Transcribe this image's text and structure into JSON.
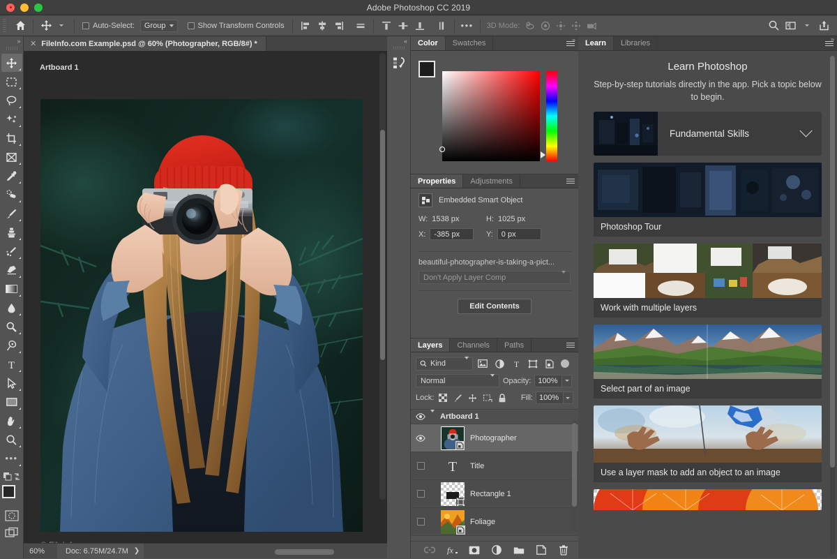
{
  "window": {
    "title": "Adobe Photoshop CC 2019"
  },
  "options_bar": {
    "home_icon": "home-icon",
    "tool_icon": "move-tool-icon",
    "auto_select_label": "Auto-Select:",
    "auto_select_value": "Group",
    "show_transform_label": "Show Transform Controls",
    "more_label": "•••",
    "three_d_mode_label": "3D Mode:",
    "align_icons": [
      "align-left-edges-icon",
      "align-horizontal-centers-icon",
      "align-right-edges-icon",
      "distribute-horizontally-icon"
    ],
    "align_icons2": [
      "align-top-edges-icon",
      "align-vertical-centers-icon",
      "align-bottom-edges-icon",
      "distribute-vertically-icon"
    ],
    "threed_icons": [
      "3d-orbit-icon",
      "3d-roll-icon",
      "3d-pan-icon",
      "3d-slide-icon",
      "3d-camera-icon"
    ],
    "right_icons": [
      "search-icon",
      "workspace-icon",
      "chevron-down-icon",
      "share-icon"
    ]
  },
  "toolbar": {
    "collapse_label": "»",
    "tools": [
      {
        "name": "move-tool",
        "active": true
      },
      {
        "name": "rectangular-marquee-tool",
        "active": false
      },
      {
        "name": "lasso-tool",
        "active": false
      },
      {
        "name": "object-selection-tool",
        "active": false
      },
      {
        "name": "crop-tool",
        "active": false
      },
      {
        "name": "frame-tool",
        "active": false
      },
      {
        "name": "eyedropper-tool",
        "active": false
      },
      {
        "name": "spot-healing-brush-tool",
        "active": false
      },
      {
        "name": "brush-tool",
        "active": false
      },
      {
        "name": "clone-stamp-tool",
        "active": false
      },
      {
        "name": "history-brush-tool",
        "active": false
      },
      {
        "name": "eraser-tool",
        "active": false
      },
      {
        "name": "gradient-tool",
        "active": false
      },
      {
        "name": "blur-tool",
        "active": false
      },
      {
        "name": "dodge-tool",
        "active": false
      },
      {
        "name": "pen-tool",
        "active": false
      },
      {
        "name": "horizontal-type-tool",
        "active": false
      },
      {
        "name": "path-selection-tool",
        "active": false
      },
      {
        "name": "rectangle-tool",
        "active": false
      },
      {
        "name": "hand-tool",
        "active": false
      },
      {
        "name": "zoom-tool",
        "active": false
      },
      {
        "name": "edit-toolbar-tool",
        "active": false
      }
    ],
    "foreground_color": "#1d1d1d",
    "background_color": "#f5a623"
  },
  "document": {
    "tab_title": "FileInfo.com Example.psd @ 60% (Photographer, RGB/8#) *",
    "close_icon": "close-icon",
    "artboard_label": "Artboard 1",
    "watermark": "© FileInfo.com",
    "status": {
      "zoom": "60%",
      "doc_info": "Doc: 6.75M/24.7M",
      "expand_icon": "chevron-right-icon"
    }
  },
  "icon_dock": {
    "collapse_label": "«",
    "icons": [
      "history-actions-icon"
    ]
  },
  "color_panel": {
    "tabs": [
      {
        "label": "Color",
        "selected": true
      },
      {
        "label": "Swatches",
        "selected": false
      }
    ],
    "menu_icon": "panel-menu-icon",
    "foreground_color": "#1d1d1d",
    "background_color": "#f5a623",
    "spectrum_hue": "#ff0000"
  },
  "properties_panel": {
    "tabs": [
      {
        "label": "Properties",
        "selected": true
      },
      {
        "label": "Adjustments",
        "selected": false
      }
    ],
    "menu_icon": "panel-menu-icon",
    "object_type": "Embedded Smart Object",
    "object_icon": "smart-object-icon",
    "w_label": "W:",
    "w_value": "1538 px",
    "h_label": "H:",
    "h_value": "1025 px",
    "x_label": "X:",
    "x_value": "-385 px",
    "y_label": "Y:",
    "y_value": "0 px",
    "file_name": "beautiful-photographer-is-taking-a-pict...",
    "layer_comp": "Don't Apply Layer Comp",
    "edit_contents_label": "Edit Contents"
  },
  "layers_panel": {
    "tabs": [
      {
        "label": "Layers",
        "selected": true
      },
      {
        "label": "Channels",
        "selected": false
      },
      {
        "label": "Paths",
        "selected": false
      }
    ],
    "menu_icon": "panel-menu-icon",
    "filter_label": "Kind",
    "filter_icons": [
      "filter-pixel-icon",
      "filter-adjustment-icon",
      "filter-type-icon",
      "filter-shape-icon",
      "filter-smart-object-icon"
    ],
    "blend_mode": "Normal",
    "opacity_label": "Opacity:",
    "opacity_value": "100%",
    "lock_label": "Lock:",
    "lock_icons": [
      "lock-transparent-pixels-icon",
      "lock-image-pixels-icon",
      "lock-position-icon",
      "lock-artboard-nesting-icon",
      "lock-all-icon"
    ],
    "fill_label": "Fill:",
    "fill_value": "100%",
    "layers": [
      {
        "name": "Artboard 1",
        "type": "group",
        "visible": true,
        "selected": false,
        "expand_icon": "chevron-down-icon"
      },
      {
        "name": "Photographer",
        "type": "smart-object",
        "visible": true,
        "selected": true
      },
      {
        "name": "Title",
        "type": "text",
        "visible": false,
        "selected": false
      },
      {
        "name": "Rectangle 1",
        "type": "shape",
        "visible": false,
        "selected": false
      },
      {
        "name": "Foliage",
        "type": "smart-object",
        "visible": false,
        "selected": false
      }
    ],
    "bottom_icons": [
      "link-layers-icon",
      "layer-style-icon",
      "layer-mask-icon",
      "adjustment-layer-icon",
      "new-group-icon",
      "new-layer-icon",
      "delete-layer-icon"
    ]
  },
  "learn_panel": {
    "tabs": [
      {
        "label": "Learn",
        "selected": true
      },
      {
        "label": "Libraries",
        "selected": false
      }
    ],
    "menu_icon": "panel-menu-icon",
    "title": "Learn Photoshop",
    "subtitle": "Step-by-step tutorials directly in the app. Pick a topic below to begin.",
    "category": {
      "label": "Fundamental Skills",
      "chevron_icon": "chevron-down-icon"
    },
    "tutorials": [
      {
        "label": "Photoshop Tour"
      },
      {
        "label": "Work with multiple layers"
      },
      {
        "label": "Select part of an image"
      },
      {
        "label": "Use a layer mask to add an object to an image"
      },
      {
        "label": ""
      }
    ]
  }
}
